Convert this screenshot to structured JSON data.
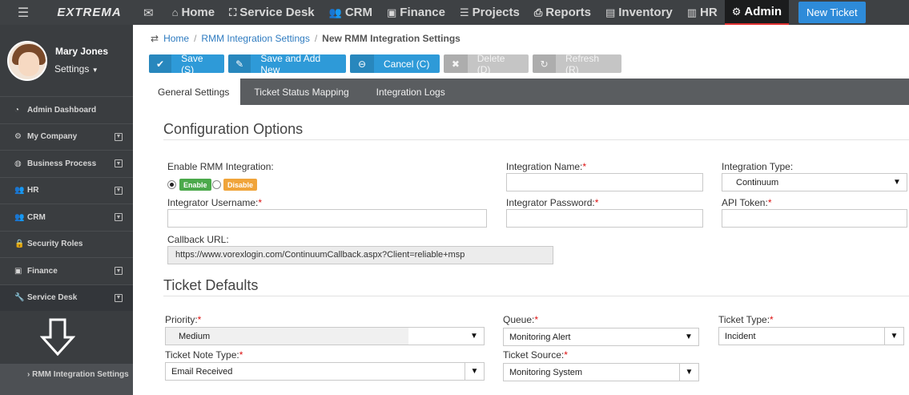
{
  "topnav": {
    "brand": "EXTREMA",
    "items": [
      {
        "label": "Home",
        "icon": "home-icon"
      },
      {
        "label": "Service Desk",
        "icon": "sitemap-icon"
      },
      {
        "label": "CRM",
        "icon": "users-icon"
      },
      {
        "label": "Finance",
        "icon": "money-icon"
      },
      {
        "label": "Projects",
        "icon": "tasks-icon"
      },
      {
        "label": "Reports",
        "icon": "print-icon"
      },
      {
        "label": "Inventory",
        "icon": "server-icon"
      },
      {
        "label": "HR",
        "icon": "briefcase-icon"
      },
      {
        "label": "Admin",
        "icon": "gear-icon"
      }
    ],
    "new_ticket": "New Ticket"
  },
  "profile": {
    "name": "Mary Jones",
    "settings": "Settings"
  },
  "sidebar": {
    "items": [
      {
        "label": "Admin Dashboard",
        "icon": "dashboard-icon",
        "expandable": false
      },
      {
        "label": "My Company",
        "icon": "gear-icon",
        "expandable": true
      },
      {
        "label": "Business Process",
        "icon": "globe-icon",
        "expandable": true
      },
      {
        "label": "HR",
        "icon": "users-icon",
        "expandable": true
      },
      {
        "label": "CRM",
        "icon": "users-icon",
        "expandable": true
      },
      {
        "label": "Security Roles",
        "icon": "lock-icon",
        "expandable": false
      },
      {
        "label": "Finance",
        "icon": "money-icon",
        "expandable": true
      },
      {
        "label": "Service Desk",
        "icon": "wrench-icon",
        "expandable": true
      }
    ],
    "sub_item": "RMM Integration Settings"
  },
  "breadcrumb": {
    "home": "Home",
    "parent": "RMM Integration Settings",
    "current": "New RMM Integration Settings"
  },
  "toolbar": {
    "save": "Save (S)",
    "save_add": "Save and Add New",
    "cancel": "Cancel (C)",
    "delete": "Delete (D)",
    "refresh": "Refresh (R)"
  },
  "tabs": [
    "General Settings",
    "Ticket Status Mapping",
    "Integration Logs"
  ],
  "config": {
    "title": "Configuration Options",
    "enable_label": "Enable RMM Integration:",
    "enable": "Enable",
    "disable": "Disable",
    "integration_name_label": "Integration Name:",
    "integration_type_label": "Integration Type:",
    "integration_type_value": "Continuum",
    "integrator_username_label": "Integrator Username:",
    "integrator_password_label": "Integrator Password:",
    "api_token_label": "API Token:",
    "callback_label": "Callback URL:",
    "callback_value": "https://www.vorexlogin.com/ContinuumCallback.aspx?Client=reliable+msp"
  },
  "defaults": {
    "title": "Ticket Defaults",
    "priority_label": "Priority:",
    "priority_value": "Medium",
    "queue_label": "Queue:",
    "queue_value": "Monitoring Alert",
    "ticket_type_label": "Ticket Type:",
    "ticket_type_value": "Incident",
    "note_type_label": "Ticket Note Type:",
    "note_type_value": "Email Received",
    "source_label": "Ticket Source:",
    "source_value": "Monitoring System"
  },
  "required_mark": "*"
}
